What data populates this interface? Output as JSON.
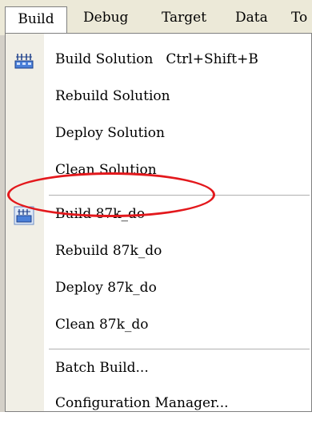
{
  "menubar": {
    "build": "Build",
    "debug": "Debug",
    "target": "Target",
    "data": "Data",
    "tools": "To"
  },
  "menu": {
    "items": [
      {
        "label": "Build Solution",
        "shortcut": "Ctrl+Shift+B",
        "icon": "build-solution-icon"
      },
      {
        "label": "Rebuild Solution"
      },
      {
        "label": "Deploy Solution"
      },
      {
        "label": "Clean Solution"
      },
      {
        "label": "Build 87k_do",
        "icon": "build-project-icon",
        "highlighted": true
      },
      {
        "label": "Rebuild 87k_do"
      },
      {
        "label": "Deploy 87k_do"
      },
      {
        "label": "Clean 87k_do"
      },
      {
        "label": "Batch Build..."
      },
      {
        "label": "Configuration Manager..."
      }
    ]
  },
  "colors": {
    "annotation_circle": "#e3181c",
    "menu_bar": "#ece9d8"
  }
}
